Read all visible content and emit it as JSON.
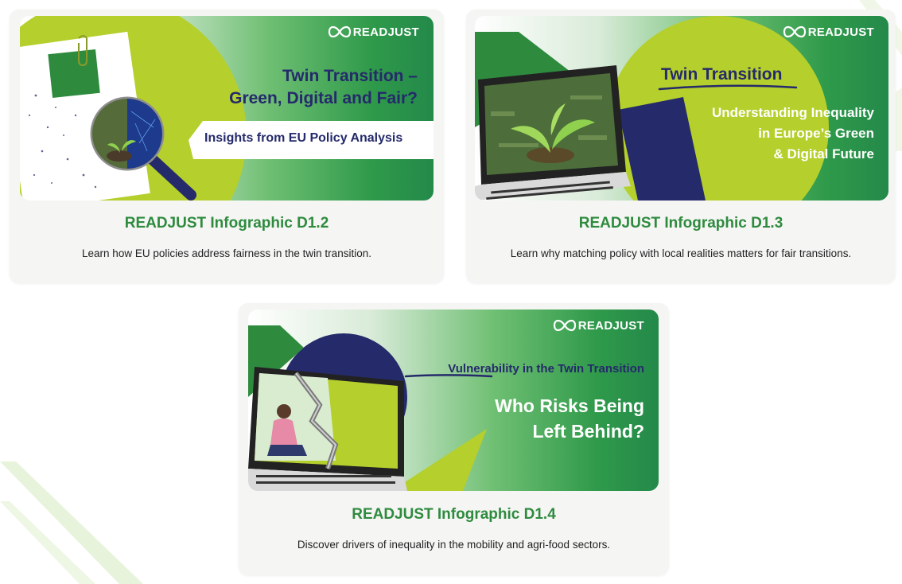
{
  "theme": {
    "title_color": "#2e8b3e",
    "banner_green": "#2f9a4a",
    "lime": "#b5cf2c",
    "navy": "#252a6b"
  },
  "cards": [
    {
      "banner": {
        "logo": "READJUST",
        "headline_line1": "Twin Transition –",
        "headline_line2": "Green, Digital and Fair?",
        "subheadline": "Insights from EU Policy Analysis"
      },
      "title": "READJUST Infographic D1.2",
      "description": "Learn how EU policies address fairness in the twin transition."
    },
    {
      "banner": {
        "logo": "READJUST",
        "headline": "Twin Transition",
        "subheadline_line1": "Understanding Inequality",
        "subheadline_line2": "in Europe’s Green",
        "subheadline_line3": "& Digital Future"
      },
      "title": "READJUST Infographic D1.3",
      "description": "Learn why matching policy with local realities matters for fair transitions."
    },
    {
      "banner": {
        "logo": "READJUST",
        "headline_emphasis": "Vulnerability",
        "headline_rest": " in the Twin Transition",
        "subheadline_line1": "Who Risks Being",
        "subheadline_line2": "Left Behind?"
      },
      "title": "READJUST Infographic D1.4",
      "description": "Discover drivers of inequality in the mobility and agri-food sectors."
    }
  ]
}
